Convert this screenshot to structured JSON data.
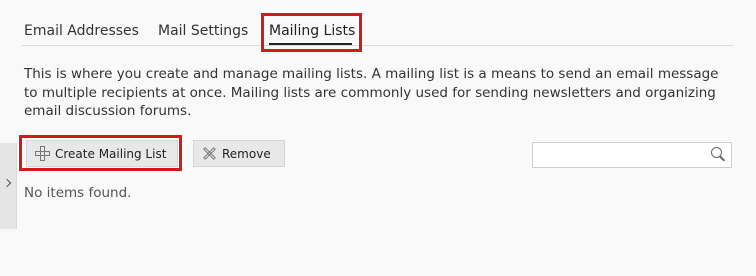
{
  "tabs": [
    {
      "label": "Email Addresses"
    },
    {
      "label": "Mail Settings"
    },
    {
      "label": "Mailing Lists"
    }
  ],
  "active_tab": "Mailing Lists",
  "description": "This is where you create and manage mailing lists. A mailing list is a means to send an email message to multiple recipients at once. Mailing lists are commonly used for sending newsletters and organizing email discussion forums.",
  "toolbar": {
    "create_label": "Create Mailing List",
    "remove_label": "Remove",
    "create_icon": "plus-icon",
    "remove_icon": "x-icon"
  },
  "search": {
    "value": "",
    "placeholder": "",
    "icon": "search-icon"
  },
  "list": {
    "empty_message": "No items found."
  },
  "colors": {
    "highlight": "#d11a1a",
    "background": "#f9f9f9",
    "button_bg": "#e8e8e8"
  }
}
